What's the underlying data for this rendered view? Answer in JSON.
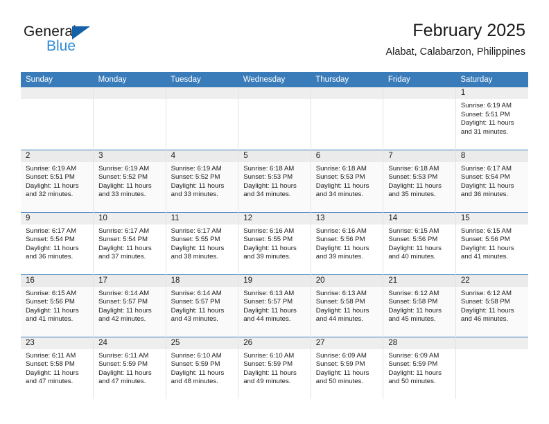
{
  "brand": {
    "name_top": "General",
    "name_bottom": "Blue",
    "triangle_color": "#1461a8",
    "blue_text_color": "#2f8bd8"
  },
  "header": {
    "title": "February 2025",
    "subtitle": "Alabat, Calabarzon, Philippines"
  },
  "theme": {
    "header_row_bg": "#3a7cba",
    "header_row_text": "#ffffff",
    "week_divider": "#3a7cba",
    "cell_divider": "#e2e2e2",
    "daynum_band": "#eeeeee",
    "shaded_row_bg": "#fafafa"
  },
  "columns": [
    "Sunday",
    "Monday",
    "Tuesday",
    "Wednesday",
    "Thursday",
    "Friday",
    "Saturday"
  ],
  "labels": {
    "sunrise": "Sunrise:",
    "sunset": "Sunset:",
    "daylight": "Daylight:"
  },
  "weeks": [
    {
      "shaded": false,
      "days": [
        {
          "day": "",
          "sunrise": "",
          "sunset": "",
          "daylight": ""
        },
        {
          "day": "",
          "sunrise": "",
          "sunset": "",
          "daylight": ""
        },
        {
          "day": "",
          "sunrise": "",
          "sunset": "",
          "daylight": ""
        },
        {
          "day": "",
          "sunrise": "",
          "sunset": "",
          "daylight": ""
        },
        {
          "day": "",
          "sunrise": "",
          "sunset": "",
          "daylight": ""
        },
        {
          "day": "",
          "sunrise": "",
          "sunset": "",
          "daylight": ""
        },
        {
          "day": "1",
          "sunrise": "Sunrise: 6:19 AM",
          "sunset": "Sunset: 5:51 PM",
          "daylight": "Daylight: 11 hours and 31 minutes."
        }
      ]
    },
    {
      "shaded": true,
      "days": [
        {
          "day": "2",
          "sunrise": "Sunrise: 6:19 AM",
          "sunset": "Sunset: 5:51 PM",
          "daylight": "Daylight: 11 hours and 32 minutes."
        },
        {
          "day": "3",
          "sunrise": "Sunrise: 6:19 AM",
          "sunset": "Sunset: 5:52 PM",
          "daylight": "Daylight: 11 hours and 33 minutes."
        },
        {
          "day": "4",
          "sunrise": "Sunrise: 6:19 AM",
          "sunset": "Sunset: 5:52 PM",
          "daylight": "Daylight: 11 hours and 33 minutes."
        },
        {
          "day": "5",
          "sunrise": "Sunrise: 6:18 AM",
          "sunset": "Sunset: 5:53 PM",
          "daylight": "Daylight: 11 hours and 34 minutes."
        },
        {
          "day": "6",
          "sunrise": "Sunrise: 6:18 AM",
          "sunset": "Sunset: 5:53 PM",
          "daylight": "Daylight: 11 hours and 34 minutes."
        },
        {
          "day": "7",
          "sunrise": "Sunrise: 6:18 AM",
          "sunset": "Sunset: 5:53 PM",
          "daylight": "Daylight: 11 hours and 35 minutes."
        },
        {
          "day": "8",
          "sunrise": "Sunrise: 6:17 AM",
          "sunset": "Sunset: 5:54 PM",
          "daylight": "Daylight: 11 hours and 36 minutes."
        }
      ]
    },
    {
      "shaded": false,
      "days": [
        {
          "day": "9",
          "sunrise": "Sunrise: 6:17 AM",
          "sunset": "Sunset: 5:54 PM",
          "daylight": "Daylight: 11 hours and 36 minutes."
        },
        {
          "day": "10",
          "sunrise": "Sunrise: 6:17 AM",
          "sunset": "Sunset: 5:54 PM",
          "daylight": "Daylight: 11 hours and 37 minutes."
        },
        {
          "day": "11",
          "sunrise": "Sunrise: 6:17 AM",
          "sunset": "Sunset: 5:55 PM",
          "daylight": "Daylight: 11 hours and 38 minutes."
        },
        {
          "day": "12",
          "sunrise": "Sunrise: 6:16 AM",
          "sunset": "Sunset: 5:55 PM",
          "daylight": "Daylight: 11 hours and 39 minutes."
        },
        {
          "day": "13",
          "sunrise": "Sunrise: 6:16 AM",
          "sunset": "Sunset: 5:56 PM",
          "daylight": "Daylight: 11 hours and 39 minutes."
        },
        {
          "day": "14",
          "sunrise": "Sunrise: 6:15 AM",
          "sunset": "Sunset: 5:56 PM",
          "daylight": "Daylight: 11 hours and 40 minutes."
        },
        {
          "day": "15",
          "sunrise": "Sunrise: 6:15 AM",
          "sunset": "Sunset: 5:56 PM",
          "daylight": "Daylight: 11 hours and 41 minutes."
        }
      ]
    },
    {
      "shaded": true,
      "days": [
        {
          "day": "16",
          "sunrise": "Sunrise: 6:15 AM",
          "sunset": "Sunset: 5:56 PM",
          "daylight": "Daylight: 11 hours and 41 minutes."
        },
        {
          "day": "17",
          "sunrise": "Sunrise: 6:14 AM",
          "sunset": "Sunset: 5:57 PM",
          "daylight": "Daylight: 11 hours and 42 minutes."
        },
        {
          "day": "18",
          "sunrise": "Sunrise: 6:14 AM",
          "sunset": "Sunset: 5:57 PM",
          "daylight": "Daylight: 11 hours and 43 minutes."
        },
        {
          "day": "19",
          "sunrise": "Sunrise: 6:13 AM",
          "sunset": "Sunset: 5:57 PM",
          "daylight": "Daylight: 11 hours and 44 minutes."
        },
        {
          "day": "20",
          "sunrise": "Sunrise: 6:13 AM",
          "sunset": "Sunset: 5:58 PM",
          "daylight": "Daylight: 11 hours and 44 minutes."
        },
        {
          "day": "21",
          "sunrise": "Sunrise: 6:12 AM",
          "sunset": "Sunset: 5:58 PM",
          "daylight": "Daylight: 11 hours and 45 minutes."
        },
        {
          "day": "22",
          "sunrise": "Sunrise: 6:12 AM",
          "sunset": "Sunset: 5:58 PM",
          "daylight": "Daylight: 11 hours and 46 minutes."
        }
      ]
    },
    {
      "shaded": false,
      "days": [
        {
          "day": "23",
          "sunrise": "Sunrise: 6:11 AM",
          "sunset": "Sunset: 5:58 PM",
          "daylight": "Daylight: 11 hours and 47 minutes."
        },
        {
          "day": "24",
          "sunrise": "Sunrise: 6:11 AM",
          "sunset": "Sunset: 5:59 PM",
          "daylight": "Daylight: 11 hours and 47 minutes."
        },
        {
          "day": "25",
          "sunrise": "Sunrise: 6:10 AM",
          "sunset": "Sunset: 5:59 PM",
          "daylight": "Daylight: 11 hours and 48 minutes."
        },
        {
          "day": "26",
          "sunrise": "Sunrise: 6:10 AM",
          "sunset": "Sunset: 5:59 PM",
          "daylight": "Daylight: 11 hours and 49 minutes."
        },
        {
          "day": "27",
          "sunrise": "Sunrise: 6:09 AM",
          "sunset": "Sunset: 5:59 PM",
          "daylight": "Daylight: 11 hours and 50 minutes."
        },
        {
          "day": "28",
          "sunrise": "Sunrise: 6:09 AM",
          "sunset": "Sunset: 5:59 PM",
          "daylight": "Daylight: 11 hours and 50 minutes."
        },
        {
          "day": "",
          "sunrise": "",
          "sunset": "",
          "daylight": ""
        }
      ]
    }
  ]
}
